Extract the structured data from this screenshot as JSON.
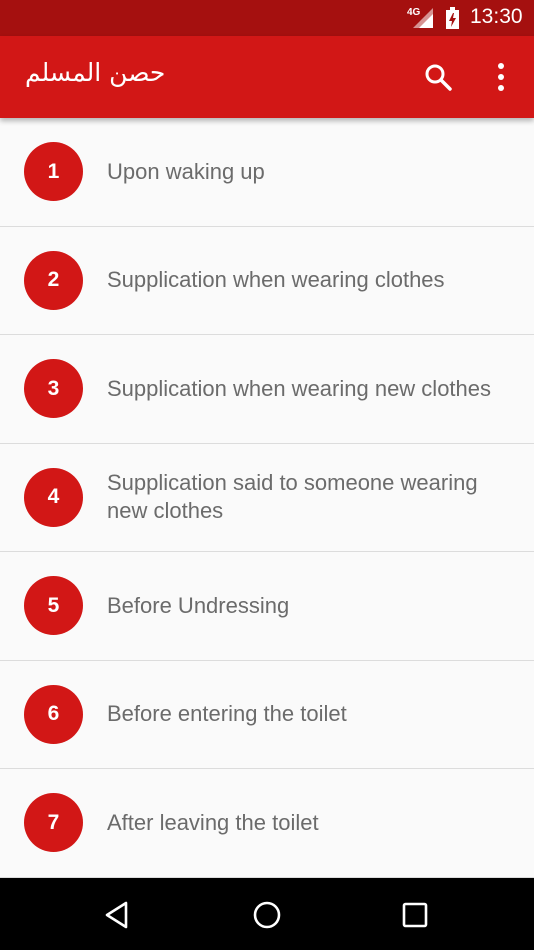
{
  "status_bar": {
    "network": "4G",
    "time": "13:30"
  },
  "app_bar": {
    "title": "حصن المسلم",
    "search_icon": "search-icon",
    "more_icon": "more-vert-icon"
  },
  "colors": {
    "primary": "#d21716",
    "status": "#a5100f",
    "text": "#6b6b6b"
  },
  "list": {
    "items": [
      {
        "number": "1",
        "label": "Upon waking up"
      },
      {
        "number": "2",
        "label": "Supplication when wearing clothes"
      },
      {
        "number": "3",
        "label": "Supplication when wearing new clothes"
      },
      {
        "number": "4",
        "label": "Supplication said to someone wearing new clothes"
      },
      {
        "number": "5",
        "label": "Before Undressing"
      },
      {
        "number": "6",
        "label": "Before entering the toilet"
      },
      {
        "number": "7",
        "label": "After leaving the toilet"
      }
    ]
  },
  "nav_bar": {
    "back_icon": "back-icon",
    "home_icon": "home-icon",
    "recents_icon": "recents-icon"
  }
}
